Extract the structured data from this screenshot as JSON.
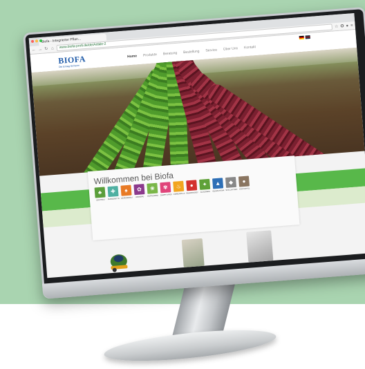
{
  "browser": {
    "tab_title": "Biofa - Integrierter Pflan...",
    "url": "www.biofa-profi.de/de/Artikle-2",
    "controls": {
      "back": "←",
      "forward": "→",
      "reload": "↻",
      "home": "⌂"
    },
    "toolbar_icons": [
      "☆",
      "✪",
      "●",
      "≡"
    ]
  },
  "site": {
    "logo_text": "BIOFA",
    "logo_tagline": "Die Ertrag-Sicherer",
    "nav": [
      "Home",
      "Produkte",
      "Beratung",
      "Bestellung",
      "Service",
      "Über Uns",
      "Kontakt"
    ],
    "welcome_title": "Willkommen bei Biofa",
    "categories": [
      {
        "label": "OBSTBAU",
        "color": "#5a9e3a",
        "icon": "♣"
      },
      {
        "label": "DÜNGEMITTEL",
        "color": "#4fb0a2",
        "icon": "✚"
      },
      {
        "label": "GEMÜSEBAU",
        "color": "#e87a25",
        "icon": "♠"
      },
      {
        "label": "WEINBAU",
        "color": "#8b3a8c",
        "icon": "✿"
      },
      {
        "label": "HOPFENBAU",
        "color": "#7ab648",
        "icon": "❀"
      },
      {
        "label": "ZIERPFLANZEN",
        "color": "#e0447a",
        "icon": "✾"
      },
      {
        "label": "ZIMMERPFLANZEN",
        "color": "#f2a51f",
        "icon": "♨"
      },
      {
        "label": "BEERENOBST",
        "color": "#d3322e",
        "icon": "●"
      },
      {
        "label": "ACKERBAU",
        "color": "#5fa138",
        "icon": "✦"
      },
      {
        "label": "GEWÄCHSHAUS",
        "color": "#2d6fb6",
        "icon": "▲"
      },
      {
        "label": "STALLHYGIENE",
        "color": "#888888",
        "icon": "◆"
      },
      {
        "label": "KARTOFFEL",
        "color": "#8a7560",
        "icon": "●"
      }
    ]
  },
  "colors": {
    "background": "#a9d4b0",
    "brand_blue": "#1e5aa8",
    "band_green": "#58b84a"
  }
}
